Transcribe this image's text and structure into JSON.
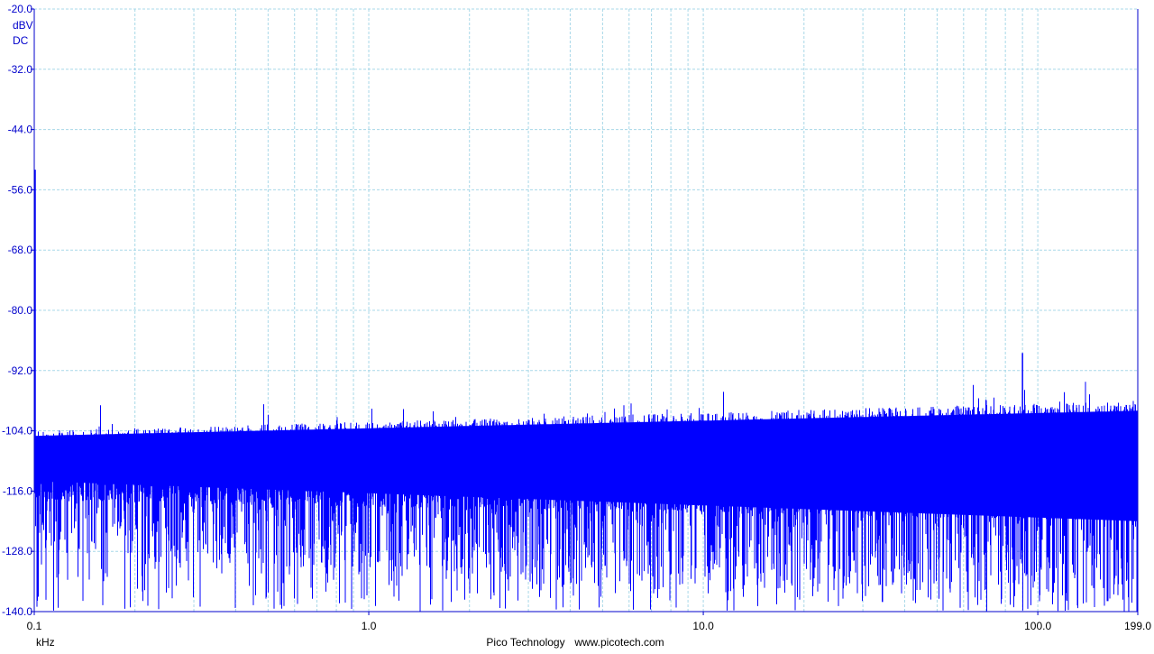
{
  "chart_data": {
    "type": "line",
    "title": "",
    "xlabel": "kHz",
    "ylabel_lines": [
      "dBV",
      "DC"
    ],
    "x_scale": "log",
    "xlim": [
      0.1,
      199.0
    ],
    "ylim": [
      -140.0,
      -20.0
    ],
    "x_ticks": [
      0.1,
      1.0,
      10.0,
      100.0,
      199.0
    ],
    "x_tick_labels": [
      "0.1",
      "1.0",
      "10.0",
      "100.0",
      "199.0"
    ],
    "y_ticks": [
      -20.0,
      -32.0,
      -44.0,
      -56.0,
      -68.0,
      -80.0,
      -92.0,
      -104.0,
      -116.0,
      -128.0,
      -140.0
    ],
    "y_tick_labels": [
      "-20.0",
      "-32.0",
      "-44.0",
      "-56.0",
      "-68.0",
      "-80.0",
      "-92.0",
      "-104.0",
      "-116.0",
      "-128.0",
      "-140.0"
    ],
    "grid": true,
    "series": [
      {
        "color": "#0000ff",
        "description_points": [
          {
            "x": 0.1,
            "y_max": -52.0,
            "y_min": -112.0
          },
          {
            "x": 0.2,
            "y_max": -101.0,
            "y_min": -140.0
          },
          {
            "x": 1.0,
            "y_max": -103.0,
            "y_min": -140.0
          },
          {
            "x": 10.0,
            "y_max": -100.0,
            "y_min": -140.0
          },
          {
            "x": 90.0,
            "y_max": -88.0,
            "y_min": -140.0
          },
          {
            "x": 199.0,
            "y_max": -97.0,
            "y_min": -140.0
          }
        ]
      }
    ],
    "colors": {
      "axis": "#0000cc",
      "grid": "#a8d8e8",
      "trace": "#0000ff",
      "background": "#ffffff"
    }
  },
  "footer": {
    "brand": "Pico Technology",
    "website": "www.picotech.com"
  }
}
